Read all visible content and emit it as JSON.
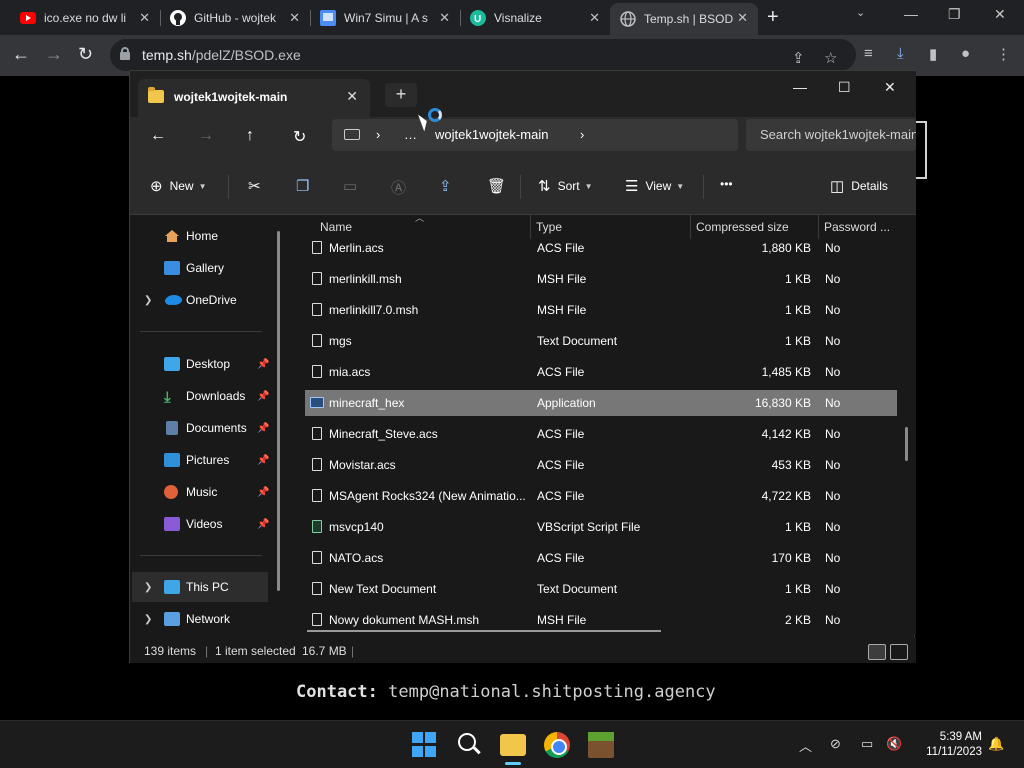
{
  "browser": {
    "tabs": [
      {
        "title": "ico.exe no dw li",
        "icon": "youtube-icon",
        "color": "#ff0000"
      },
      {
        "title": "GitHub - wojtek",
        "icon": "github-icon",
        "color": "#ffffff"
      },
      {
        "title": "Win7 Simu | A s",
        "icon": "win7simu-icon",
        "color": "#4b8cf5"
      },
      {
        "title": "Visnalize",
        "icon": "visnalize-icon",
        "color": "#1abc9c"
      },
      {
        "title": "Temp.sh | BSOD",
        "icon": "globe-icon",
        "color": "#bdc1c6"
      }
    ],
    "url_host": "temp.sh",
    "url_path": "/pdelZ/BSOD.exe"
  },
  "explorer": {
    "tab_title": "wojtek1wojtek-main",
    "breadcrumb": [
      "…",
      "wojtek1wojtek-main"
    ],
    "search_placeholder": "Search wojtek1wojtek-main",
    "toolbar": {
      "new": "New",
      "sort": "Sort",
      "view": "View",
      "more": "•••",
      "details": "Details"
    },
    "nav": [
      {
        "label": "Home",
        "icon": "home-icon",
        "pinned": false,
        "expandable": false
      },
      {
        "label": "Gallery",
        "icon": "gallery-icon",
        "pinned": false,
        "expandable": false
      },
      {
        "label": "OneDrive",
        "icon": "onedrive-icon",
        "pinned": false,
        "expandable": true
      },
      {
        "label": "Desktop",
        "icon": "desktop-icon",
        "pinned": true,
        "expandable": false
      },
      {
        "label": "Downloads",
        "icon": "downloads-icon",
        "pinned": true,
        "expandable": false
      },
      {
        "label": "Documents",
        "icon": "documents-icon",
        "pinned": true,
        "expandable": false
      },
      {
        "label": "Pictures",
        "icon": "pictures-icon",
        "pinned": true,
        "expandable": false
      },
      {
        "label": "Music",
        "icon": "music-icon",
        "pinned": true,
        "expandable": false
      },
      {
        "label": "Videos",
        "icon": "videos-icon",
        "pinned": true,
        "expandable": false
      },
      {
        "label": "This PC",
        "icon": "this-pc-icon",
        "pinned": false,
        "expandable": true
      },
      {
        "label": "Network",
        "icon": "network-icon",
        "pinned": false,
        "expandable": true
      }
    ],
    "columns": [
      "Name",
      "Type",
      "Compressed size",
      "Password ..."
    ],
    "files": [
      {
        "name": "Merlin.acs",
        "type": "ACS File",
        "size": "1,880 KB",
        "password": "No"
      },
      {
        "name": "merlinkill.msh",
        "type": "MSH File",
        "size": "1 KB",
        "password": "No"
      },
      {
        "name": "merlinkill7.0.msh",
        "type": "MSH File",
        "size": "1 KB",
        "password": "No"
      },
      {
        "name": "mgs",
        "type": "Text Document",
        "size": "1 KB",
        "password": "No"
      },
      {
        "name": "mia.acs",
        "type": "ACS File",
        "size": "1,485 KB",
        "password": "No"
      },
      {
        "name": "minecraft_hex",
        "type": "Application",
        "size": "16,830 KB",
        "password": "No"
      },
      {
        "name": "Minecraft_Steve.acs",
        "type": "ACS File",
        "size": "4,142 KB",
        "password": "No"
      },
      {
        "name": "Movistar.acs",
        "type": "ACS File",
        "size": "453 KB",
        "password": "No"
      },
      {
        "name": "MSAgent Rocks324 (New Animatio...",
        "type": "ACS File",
        "size": "4,722 KB",
        "password": "No"
      },
      {
        "name": "msvcp140",
        "type": "VBScript Script File",
        "size": "1 KB",
        "password": "No"
      },
      {
        "name": "NATO.acs",
        "type": "ACS File",
        "size": "170 KB",
        "password": "No"
      },
      {
        "name": "New Text Document",
        "type": "Text Document",
        "size": "1 KB",
        "password": "No"
      },
      {
        "name": "Nowy dokument MASH.msh",
        "type": "MSH File",
        "size": "2 KB",
        "password": "No"
      }
    ],
    "selected_file": "minecraft_hex",
    "status": {
      "count": "139 items",
      "selected": "1 item selected",
      "size": "16.7 MB"
    }
  },
  "page": {
    "contact_label": "Contact:",
    "contact_value": "temp@national.shitposting.agency"
  },
  "taskbar": {
    "apps": [
      "start-icon",
      "search-icon",
      "file-explorer-icon",
      "chrome-icon",
      "minecraft-icon"
    ],
    "time": "5:39 AM",
    "date": "11/11/2023"
  }
}
